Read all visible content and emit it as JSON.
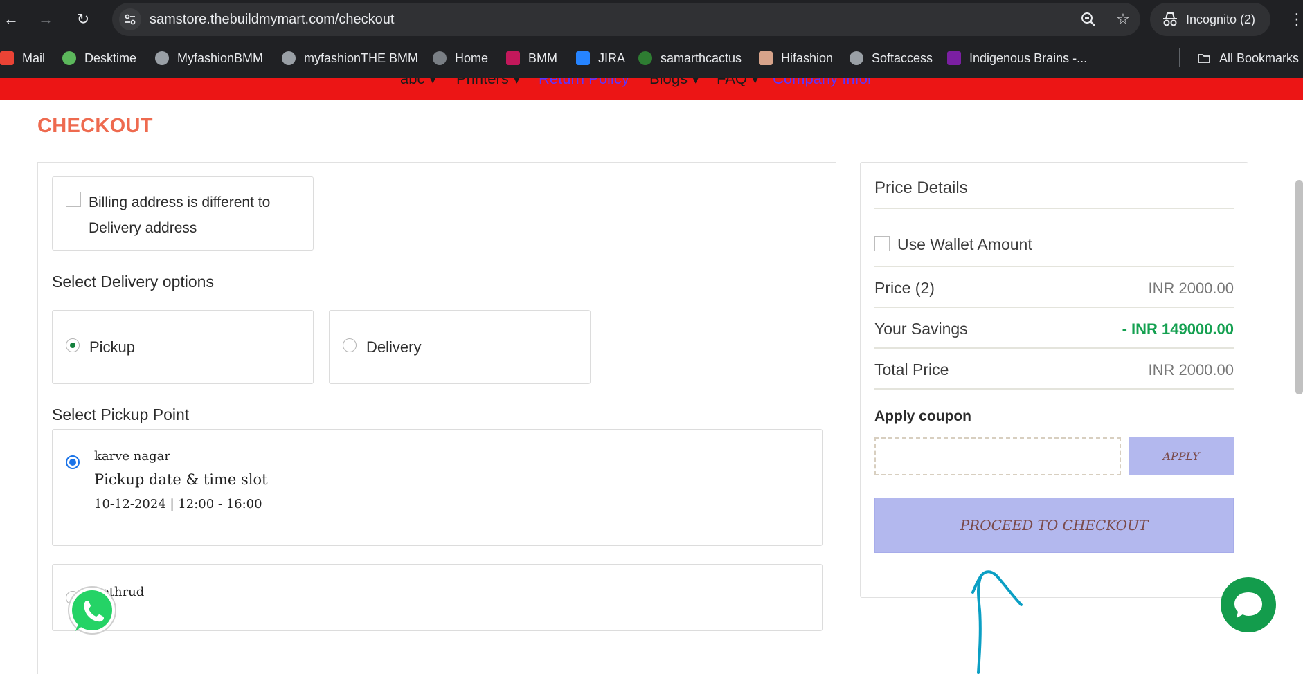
{
  "browser": {
    "url": "samstore.thebuildmymart.com/checkout",
    "incognito_label": "Incognito (2)",
    "bookmarks": [
      {
        "label": "Mail",
        "color": "#ea4335"
      },
      {
        "label": "Desktime",
        "color": "#5cb85c"
      },
      {
        "label": "MyfashionBMM",
        "color": "#9aa0a6"
      },
      {
        "label": "myfashionTHE BMM",
        "color": "#9aa0a6"
      },
      {
        "label": "Home",
        "color": "#9aa0a6"
      },
      {
        "label": "BMM",
        "color": "#c2185b"
      },
      {
        "label": "JIRA",
        "color": "#2684ff"
      },
      {
        "label": "samarthcactus",
        "color": "#2e7d32"
      },
      {
        "label": "Hifashion",
        "color": "#d7a38a"
      },
      {
        "label": "Softaccess",
        "color": "#9aa0a6"
      },
      {
        "label": "Indigenous Brains -...",
        "color": "#7b1fa2"
      }
    ],
    "all_bookmarks_label": "All Bookmarks"
  },
  "site_nav": {
    "items": [
      "abc ▾",
      "Printers ▾",
      "Return Policy",
      "Blogs ▾",
      "FAQ ▾",
      "Company Infor"
    ]
  },
  "page": {
    "title": "CHECKOUT",
    "billing_checkbox_label": "Billing address is different to Delivery address",
    "delivery_heading": "Select Delivery options",
    "delivery_options": [
      "Pickup",
      "Delivery"
    ],
    "pickup_point_heading": "Select Pickup Point",
    "pickup_points": [
      {
        "name": "karve nagar",
        "slot_heading": "Pickup date & time slot",
        "slot": "10-12-2024 | 12:00 - 16:00"
      },
      {
        "name": "kothrud"
      }
    ]
  },
  "price_details": {
    "title": "Price Details",
    "wallet_label": "Use Wallet Amount",
    "rows": [
      {
        "label": "Price (2)",
        "value": "INR 2000.00"
      },
      {
        "label": "Your Savings",
        "value": "- INR 149000.00"
      },
      {
        "label": "Total Price",
        "value": "INR 2000.00"
      }
    ],
    "coupon_heading": "Apply coupon",
    "coupon_value": "",
    "apply_label": "APPLY",
    "checkout_label": "PROCEED TO CHECKOUT"
  },
  "colors": {
    "accent_title": "#ee6a4f",
    "nav_bar": "#ec1515",
    "button_bg": "#b3b8ee",
    "savings_green": "#14a050",
    "whatsapp": "#25d366"
  }
}
